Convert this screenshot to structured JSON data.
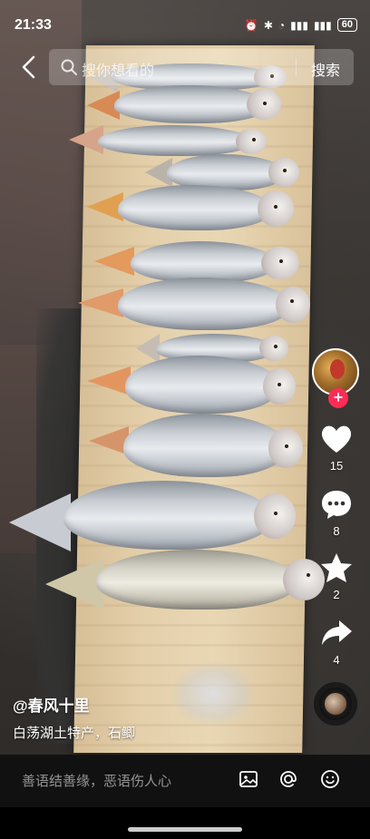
{
  "status_bar": {
    "time": "21:33",
    "battery": "60"
  },
  "search": {
    "placeholder": "搜你想看的",
    "button": "搜索"
  },
  "actions": {
    "likes": "15",
    "comments": "8",
    "favorites": "2",
    "shares": "4"
  },
  "caption": {
    "author": "@春风十里",
    "description": "白荡湖土特产，石鲫"
  },
  "comment_bar": {
    "placeholder": "善语结善缘，恶语伤人心"
  },
  "colors": {
    "follow_badge": "#fe2c55",
    "like_icon": "#ffffff"
  }
}
